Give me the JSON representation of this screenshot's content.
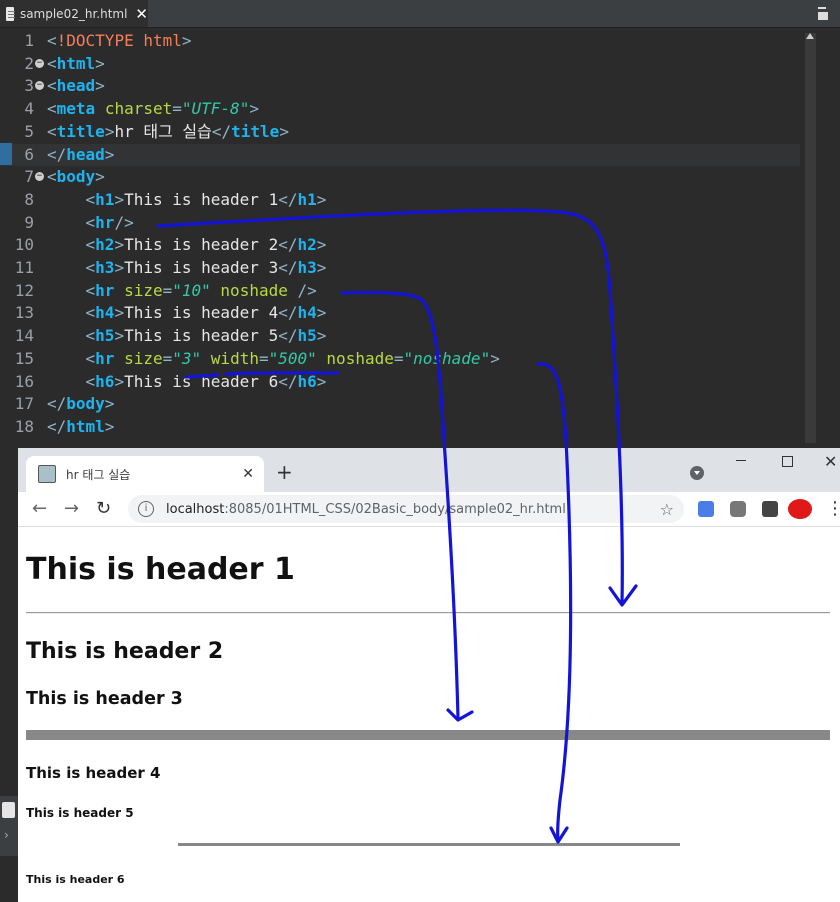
{
  "editor": {
    "tab_title": "sample02_hr.html",
    "close_glyph": "✕",
    "lines": [
      {
        "n": "1",
        "tokens": [
          [
            "pun",
            "<"
          ],
          [
            "kw",
            "!DOCTYPE "
          ],
          [
            "kw",
            "html"
          ],
          [
            "pun",
            ">"
          ]
        ]
      },
      {
        "n": "2",
        "fold": true,
        "tokens": [
          [
            "pun",
            "<"
          ],
          [
            "tag",
            "html"
          ],
          [
            "pun",
            ">"
          ]
        ]
      },
      {
        "n": "3",
        "fold": true,
        "tokens": [
          [
            "pun",
            "<"
          ],
          [
            "tag",
            "head"
          ],
          [
            "pun",
            ">"
          ]
        ]
      },
      {
        "n": "4",
        "tokens": [
          [
            "pun",
            "<"
          ],
          [
            "tag",
            "meta "
          ],
          [
            "attr",
            "charset"
          ],
          [
            "pun",
            "="
          ],
          [
            "val",
            "\"UTF-8\""
          ],
          [
            "pun",
            ">"
          ]
        ]
      },
      {
        "n": "5",
        "tokens": [
          [
            "pun",
            "<"
          ],
          [
            "tag",
            "title"
          ],
          [
            "pun",
            ">"
          ],
          [
            "txt",
            "hr 태그 실습"
          ],
          [
            "pun",
            "</"
          ],
          [
            "tag",
            "title"
          ],
          [
            "pun",
            ">"
          ]
        ]
      },
      {
        "n": "6",
        "current": true,
        "tokens": [
          [
            "pun",
            "</"
          ],
          [
            "tag",
            "head"
          ],
          [
            "pun",
            ">"
          ]
        ]
      },
      {
        "n": "7",
        "fold": true,
        "tokens": [
          [
            "pun",
            "<"
          ],
          [
            "tag",
            "body"
          ],
          [
            "pun",
            ">"
          ]
        ]
      },
      {
        "n": "8",
        "tokens": [
          [
            "txt",
            "    "
          ],
          [
            "pun",
            "<"
          ],
          [
            "tag",
            "h1"
          ],
          [
            "pun",
            ">"
          ],
          [
            "txt",
            "This is header 1"
          ],
          [
            "pun",
            "</"
          ],
          [
            "tag",
            "h1"
          ],
          [
            "pun",
            ">"
          ]
        ]
      },
      {
        "n": "9",
        "tokens": [
          [
            "txt",
            "    "
          ],
          [
            "pun",
            "<"
          ],
          [
            "tag",
            "hr"
          ],
          [
            "pun",
            "/>"
          ]
        ]
      },
      {
        "n": "10",
        "tokens": [
          [
            "txt",
            "    "
          ],
          [
            "pun",
            "<"
          ],
          [
            "tag",
            "h2"
          ],
          [
            "pun",
            ">"
          ],
          [
            "txt",
            "This is header 2"
          ],
          [
            "pun",
            "</"
          ],
          [
            "tag",
            "h2"
          ],
          [
            "pun",
            ">"
          ]
        ]
      },
      {
        "n": "11",
        "tokens": [
          [
            "txt",
            "    "
          ],
          [
            "pun",
            "<"
          ],
          [
            "tag",
            "h3"
          ],
          [
            "pun",
            ">"
          ],
          [
            "txt",
            "This is header 3"
          ],
          [
            "pun",
            "</"
          ],
          [
            "tag",
            "h3"
          ],
          [
            "pun",
            ">"
          ]
        ]
      },
      {
        "n": "12",
        "tokens": [
          [
            "txt",
            "    "
          ],
          [
            "pun",
            "<"
          ],
          [
            "tag",
            "hr "
          ],
          [
            "attr",
            "size"
          ],
          [
            "pun",
            "="
          ],
          [
            "val",
            "\"10\""
          ],
          [
            "txt",
            " "
          ],
          [
            "attr",
            "noshade"
          ],
          [
            "txt",
            " "
          ],
          [
            "pun",
            "/>"
          ]
        ]
      },
      {
        "n": "13",
        "tokens": [
          [
            "txt",
            "    "
          ],
          [
            "pun",
            "<"
          ],
          [
            "tag",
            "h4"
          ],
          [
            "pun",
            ">"
          ],
          [
            "txt",
            "This is header 4"
          ],
          [
            "pun",
            "</"
          ],
          [
            "tag",
            "h4"
          ],
          [
            "pun",
            ">"
          ]
        ]
      },
      {
        "n": "14",
        "tokens": [
          [
            "txt",
            "    "
          ],
          [
            "pun",
            "<"
          ],
          [
            "tag",
            "h5"
          ],
          [
            "pun",
            ">"
          ],
          [
            "txt",
            "This is header 5"
          ],
          [
            "pun",
            "</"
          ],
          [
            "tag",
            "h5"
          ],
          [
            "pun",
            ">"
          ]
        ]
      },
      {
        "n": "15",
        "tokens": [
          [
            "txt",
            "    "
          ],
          [
            "pun",
            "<"
          ],
          [
            "tag",
            "hr "
          ],
          [
            "attr",
            "size"
          ],
          [
            "pun",
            "="
          ],
          [
            "val",
            "\"3\""
          ],
          [
            "txt",
            " "
          ],
          [
            "attr",
            "width"
          ],
          [
            "pun",
            "="
          ],
          [
            "val",
            "\"500\""
          ],
          [
            "txt",
            " "
          ],
          [
            "attr",
            "noshade"
          ],
          [
            "pun",
            "="
          ],
          [
            "val",
            "\"noshade\""
          ],
          [
            "pun",
            ">"
          ]
        ]
      },
      {
        "n": "16",
        "tokens": [
          [
            "txt",
            "    "
          ],
          [
            "pun",
            "<"
          ],
          [
            "tag",
            "h6"
          ],
          [
            "pun",
            ">"
          ],
          [
            "txt",
            "This is header 6"
          ],
          [
            "pun",
            "</"
          ],
          [
            "tag",
            "h6"
          ],
          [
            "pun",
            ">"
          ]
        ]
      },
      {
        "n": "17",
        "tokens": [
          [
            "pun",
            "</"
          ],
          [
            "tag",
            "body"
          ],
          [
            "pun",
            ">"
          ]
        ]
      },
      {
        "n": "18",
        "tokens": [
          [
            "pun",
            "</"
          ],
          [
            "tag",
            "html"
          ],
          [
            "pun",
            ">"
          ]
        ]
      }
    ]
  },
  "browser": {
    "tab_title": "hr 태그 실습",
    "tab_close": "✕",
    "new_tab": "+",
    "win_close": "✕",
    "url_host": "localhost",
    "url_path": ":8085/01HTML_CSS/02Basic_body/sample02_hr.html",
    "info": "i",
    "star": "☆",
    "back": "←",
    "forward": "→",
    "reload": "↻",
    "menu": "⋮",
    "page": {
      "h1": "This is header 1",
      "h2": "This is header 2",
      "h3": "This is header 3",
      "h4": "This is header 4",
      "h5": "This is header 5",
      "h6": "This is header 6"
    }
  },
  "annotation_color": "#1414d8",
  "colors": {
    "tag": "#1eb3ef",
    "attr": "#b9d944",
    "value": "#33c8a8",
    "keyword": "#f67e59",
    "hr": "#888888"
  }
}
